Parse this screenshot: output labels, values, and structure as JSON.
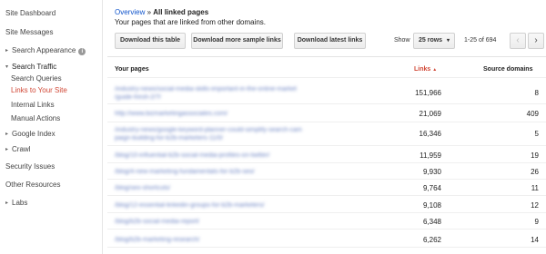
{
  "sidebar": {
    "items": [
      {
        "label": "Site Dashboard"
      },
      {
        "label": "Site Messages"
      },
      {
        "label": "Search Appearance"
      },
      {
        "label": "Search Traffic"
      },
      {
        "label": "Search Queries"
      },
      {
        "label": "Links to Your Site"
      },
      {
        "label": "Internal Links"
      },
      {
        "label": "Manual Actions"
      },
      {
        "label": "Google Index"
      },
      {
        "label": "Crawl"
      },
      {
        "label": "Security Issues"
      },
      {
        "label": "Other Resources"
      },
      {
        "label": "Labs"
      }
    ],
    "info_glyph": "i",
    "caret_right": "▸",
    "caret_down": "▾"
  },
  "breadcrumb": {
    "parent": "Overview",
    "separator": " » ",
    "current": "All linked pages"
  },
  "subtitle": "Your pages that are linked from other domains.",
  "toolbar": {
    "download_table": "Download this table",
    "download_sample": "Download more sample links",
    "download_latest": "Download latest links",
    "show_label": "Show",
    "rows_value": "25 rows",
    "rows_arrow": "▾",
    "range": "1-25 of 694",
    "prev": "‹",
    "next": "›"
  },
  "table": {
    "headers": {
      "pages": "Your pages",
      "links": "Links",
      "sort_indicator": "▲",
      "domains": "Source domains"
    },
    "rows": [
      {
        "page": "/industry-news/social-media-skills-important-in-the-online-market",
        "page2": "/guide-fresh-2/?/",
        "links": "151,966",
        "domains": "8"
      },
      {
        "page": "http://www.bizmarketingassociates.com/",
        "page2": "",
        "links": "21,069",
        "domains": "409"
      },
      {
        "page": "/industry-news/google-keyword-planner-could-simplify-search-cam",
        "page2": "paign-building-for-b2b-marketers-11/0/",
        "links": "16,346",
        "domains": "5"
      },
      {
        "page": "/blog/10-influential-b2b-social-media-profiles-on-twitter/",
        "page2": "",
        "links": "11,959",
        "domains": "19"
      },
      {
        "page": "/blog/4-new-marketing-fundamentals-for-b2b-seo/",
        "page2": "",
        "links": "9,930",
        "domains": "26"
      },
      {
        "page": "/blog/seo-shortcuts/",
        "page2": "",
        "links": "9,764",
        "domains": "11"
      },
      {
        "page": "/blog/12-essential-linkedin-groups-for-b2b-marketers/",
        "page2": "",
        "links": "9,108",
        "domains": "12"
      },
      {
        "page": "/blog/b2b-social-media-report/",
        "page2": "",
        "links": "6,348",
        "domains": "9"
      },
      {
        "page": "/blog/b2b-marketing-research/",
        "page2": "",
        "links": "6,262",
        "domains": "14"
      }
    ]
  },
  "colors": {
    "link_blue": "#1155cc",
    "active_red": "#d14836"
  }
}
